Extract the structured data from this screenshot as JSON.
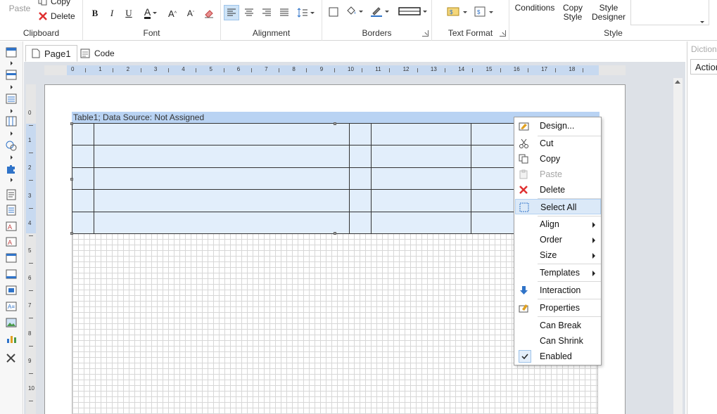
{
  "ribbon": {
    "clipboard": {
      "label": "Clipboard",
      "paste": "Paste",
      "copy": "Copy",
      "delete": "Delete"
    },
    "font": {
      "label": "Font",
      "bold": "B",
      "italic": "I",
      "underline": "U",
      "font_color": "A",
      "grow": "A",
      "shrink": "A"
    },
    "alignment": {
      "label": "Alignment"
    },
    "borders": {
      "label": "Borders"
    },
    "text_format": {
      "label": "Text Format"
    },
    "style": {
      "label": "Style",
      "conditions": "Conditions",
      "copy_style_1": "Copy",
      "copy_style_2": "Style",
      "style_designer_1": "Style",
      "style_designer_2": "Designer"
    },
    "colors": {
      "accent_red": "#e03030",
      "accent_blue": "#2f73c8"
    }
  },
  "tabs": [
    {
      "label": "Page1"
    },
    {
      "label": "Code"
    }
  ],
  "ruler": {
    "h": [
      "0",
      "1",
      "2",
      "3",
      "4",
      "5",
      "6",
      "7",
      "8",
      "9",
      "10",
      "11",
      "12",
      "13",
      "14",
      "15",
      "16",
      "17",
      "18"
    ],
    "v": [
      "0",
      "1",
      "2",
      "3",
      "4",
      "5",
      "6",
      "7",
      "8",
      "9",
      "10"
    ]
  },
  "table": {
    "header": "Table1; Data Source: Not Assigned"
  },
  "dictionary": {
    "tab": "Dictiona",
    "action": "Action"
  },
  "context_menu": {
    "design": "Design...",
    "cut": "Cut",
    "copy": "Copy",
    "paste": "Paste",
    "delete": "Delete",
    "select_all": "Select All",
    "align": "Align",
    "order": "Order",
    "size": "Size",
    "templates": "Templates",
    "interaction": "Interaction",
    "properties": "Properties",
    "can_break": "Can Break",
    "can_shrink": "Can Shrink",
    "enabled": "Enabled"
  }
}
